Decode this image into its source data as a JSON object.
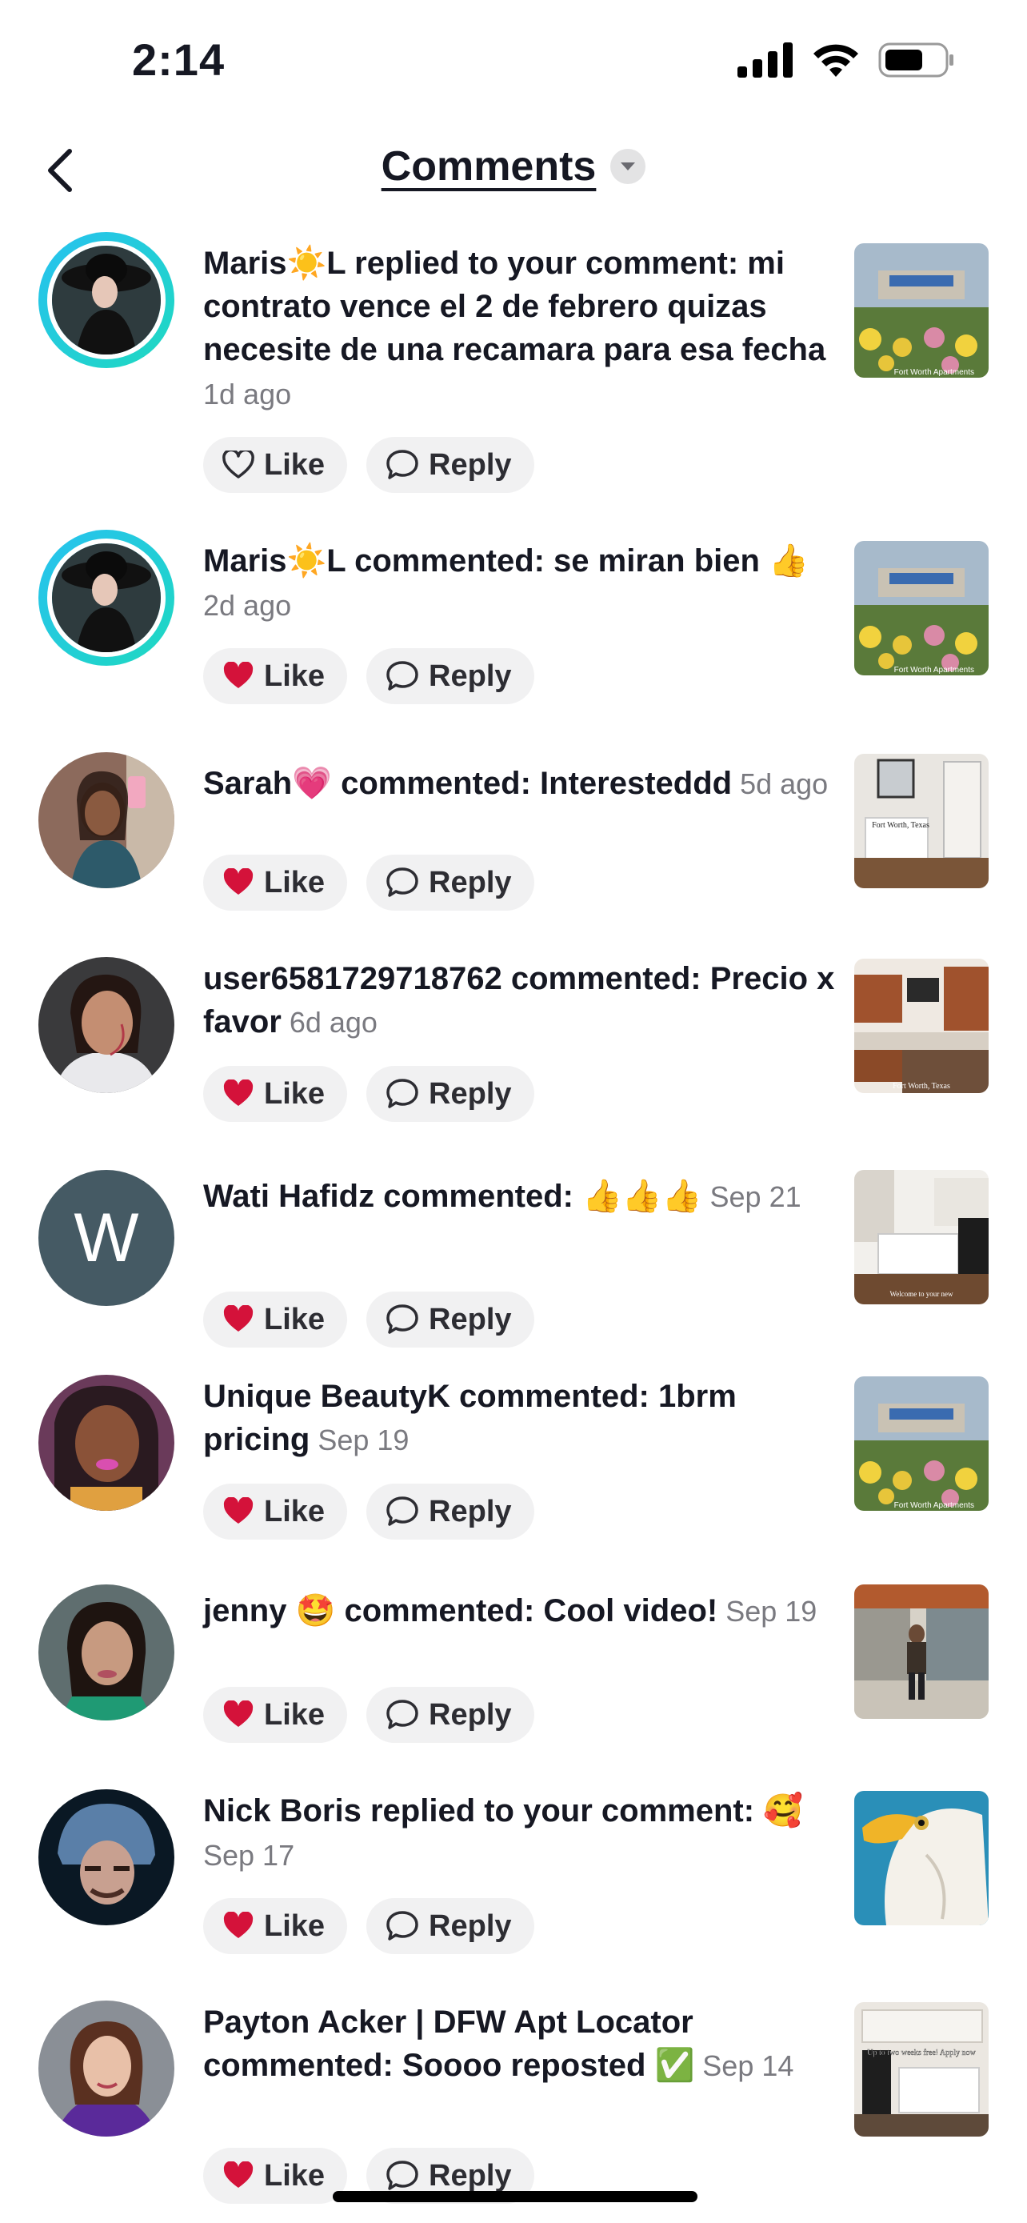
{
  "status_bar": {
    "time": "2:14"
  },
  "header": {
    "title": "Comments"
  },
  "comments": [
    {
      "name": "Maris☀️L",
      "text": " replied to your comment: mi contrato vence el 2 de febrero quizas necesite de una recamara para esa fecha",
      "time": " 1d ago",
      "liked": false,
      "like_label": "Like",
      "reply_label": "Reply",
      "thumb_text": "Fort Worth Apartments"
    },
    {
      "name": "Maris☀️L",
      "text": " commented: se miran bien 👍",
      "time": " 2d ago",
      "liked": true,
      "like_label": "Like",
      "reply_label": "Reply",
      "thumb_text": "Fort Worth Apartments"
    },
    {
      "name": "Sarah💗",
      "text": " commented: Interesteddd",
      "time": " 5d ago",
      "liked": true,
      "like_label": "Like",
      "reply_label": "Reply",
      "thumb_text": "Fort Worth, Texas"
    },
    {
      "name": "user6581729718762",
      "text": " commented: Precio x favor",
      "time": " 6d ago",
      "liked": true,
      "like_label": "Like",
      "reply_label": "Reply",
      "thumb_text": "Fort Worth, Texas"
    },
    {
      "name": "Wati Hafidz",
      "text": " commented: 👍👍👍",
      "time": " Sep 21",
      "liked": true,
      "like_label": "Like",
      "reply_label": "Reply",
      "avatar_letter": "W",
      "thumb_text": "Welcome to your new"
    },
    {
      "name": "Unique BeautyK",
      "text": " commented: 1brm pricing",
      "time": " Sep 19",
      "liked": true,
      "like_label": "Like",
      "reply_label": "Reply",
      "thumb_text": "Fort Worth Apartments"
    },
    {
      "name": "jenny 🤩",
      "text": " commented: Cool video!",
      "time": " Sep 19",
      "liked": true,
      "like_label": "Like",
      "reply_label": "Reply",
      "thumb_text": ""
    },
    {
      "name": "Nick Boris",
      "text": " replied to your comment: 🥰",
      "time": " Sep 17",
      "liked": true,
      "like_label": "Like",
      "reply_label": "Reply",
      "thumb_text": ""
    },
    {
      "name": "Payton Acker | DFW Apt Locator",
      "text": " commented: Soooo reposted ✅",
      "time": " Sep 14",
      "liked": true,
      "like_label": "Like",
      "reply_label": "Reply",
      "thumb_text": "Up to two weeks free! Apply now"
    }
  ],
  "colors": {
    "like_red": "#d4123a",
    "ring_start": "#27c1f0",
    "ring_end": "#1ed9c0",
    "pill_bg": "#f1f1f2"
  }
}
